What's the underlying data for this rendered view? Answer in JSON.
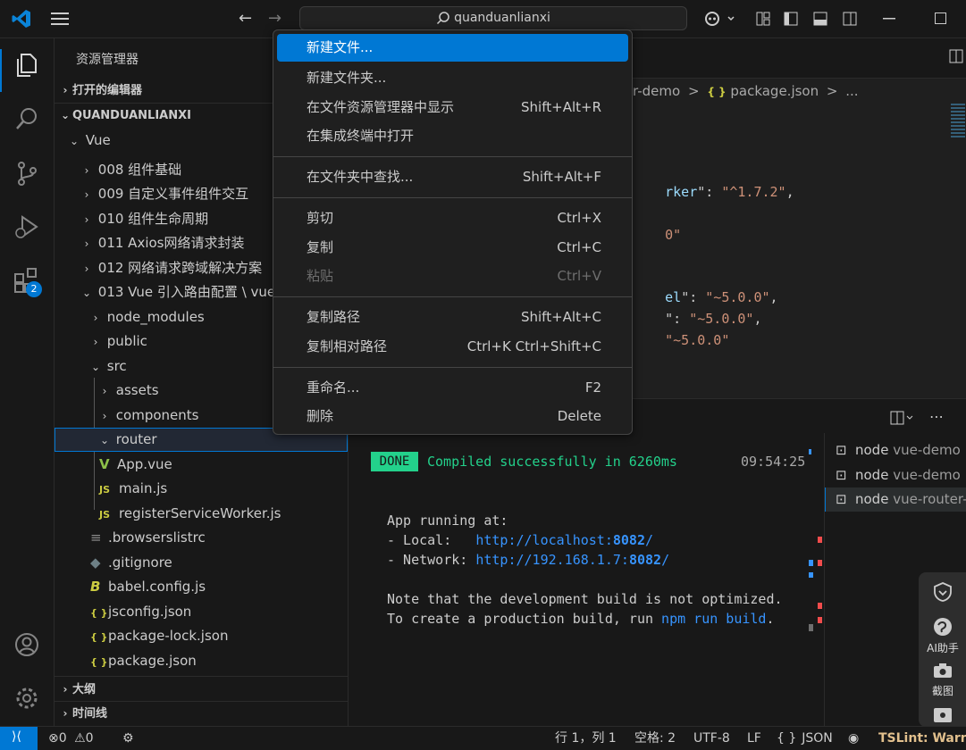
{
  "titlebar": {
    "search_text": "quanduanlianxi"
  },
  "activity": {
    "extensions_badge": "2"
  },
  "sidebar": {
    "title": "资源管理器",
    "open_editors": "打开的编辑器",
    "workspace": "QUANDUANLIANXI",
    "outline": "大纲",
    "timeline": "时间线",
    "items": [
      {
        "label": "Vue"
      },
      {
        "label": "008 组件基础"
      },
      {
        "label": "009 自定义事件组件交互"
      },
      {
        "label": "010 组件生命周期"
      },
      {
        "label": "011 Axios网络请求封装"
      },
      {
        "label": "012 网络请求跨域解决方案"
      },
      {
        "label": "013 Vue 引入路由配置 \\ vue"
      },
      {
        "label": "node_modules"
      },
      {
        "label": "public"
      },
      {
        "label": "src"
      },
      {
        "label": "assets"
      },
      {
        "label": "components"
      },
      {
        "label": "router"
      },
      {
        "label": "App.vue"
      },
      {
        "label": "main.js"
      },
      {
        "label": "registerServiceWorker.js"
      },
      {
        "label": ".browserslistrc"
      },
      {
        "label": ".gitignore"
      },
      {
        "label": "babel.config.js"
      },
      {
        "label": "jsconfig.json"
      },
      {
        "label": "package-lock.json"
      },
      {
        "label": "package.json"
      }
    ],
    "icon_js": "JS",
    "icon_json": "{ }"
  },
  "editor": {
    "breadcrumb_prev": "r-demo",
    "breadcrumb_sep": ">",
    "breadcrumb_icon": "{ }",
    "breadcrumb_file": "package.json",
    "breadcrumb_more": "...",
    "lines": [
      {
        "key": "rker",
        "rest": "\": ",
        "val": "\"^1.7.2\"",
        "end": ","
      },
      {
        "key": "",
        "rest": "",
        "val": "0\"",
        "end": ""
      },
      {
        "key": "el",
        "rest": "\": ",
        "val": "\"~5.0.0\"",
        "end": ","
      },
      {
        "key": "",
        "rest": "\": ",
        "val": "\"~5.0.0\"",
        "end": ","
      },
      {
        "key": "",
        "rest": "",
        "val": "\"~5.0.0\"",
        "end": ""
      }
    ]
  },
  "terminal": {
    "done_badge": "DONE",
    "compiled": "Compiled successfully in 6260ms",
    "time": "09:54:25",
    "app_running": "App running at:",
    "local_label": "- Local:   ",
    "local_url": "http://localhost:",
    "local_port": "8082",
    "network_label": "- Network: ",
    "network_url": "http://192.168.1.7:",
    "network_port": "8082",
    "slash": "/",
    "note1": "Note that the development build is not optimized.",
    "note2_pre": "To create a production build, run ",
    "note2_cmd": "npm run build",
    "note2_post": ".",
    "tabs": [
      {
        "name": "node",
        "desc": "vue-demo"
      },
      {
        "name": "node",
        "desc": "vue-demo"
      },
      {
        "name": "node",
        "desc": "vue-router-d"
      }
    ]
  },
  "ai_panel": {
    "ai_label": "AI助手",
    "screenshot_label": "截图"
  },
  "statusbar": {
    "errors": "0",
    "warnings": "0",
    "position": "行 1，列 1",
    "spaces": "空格: 2",
    "encoding": "UTF-8",
    "eol": "LF",
    "lang_braces": "{ }",
    "language": "JSON",
    "tslint": "TSLint: Warnin"
  },
  "context_menu": {
    "items": [
      {
        "label": "新建文件...",
        "key": ""
      },
      {
        "label": "新建文件夹...",
        "key": ""
      },
      {
        "label": "在文件资源管理器中显示",
        "key": "Shift+Alt+R"
      },
      {
        "label": "在集成终端中打开",
        "key": ""
      },
      {
        "label": "在文件夹中查找...",
        "key": "Shift+Alt+F"
      },
      {
        "label": "剪切",
        "key": "Ctrl+X"
      },
      {
        "label": "复制",
        "key": "Ctrl+C"
      },
      {
        "label": "粘贴",
        "key": "Ctrl+V"
      },
      {
        "label": "复制路径",
        "key": "Shift+Alt+C"
      },
      {
        "label": "复制相对路径",
        "key": "Ctrl+K Ctrl+Shift+C"
      },
      {
        "label": "重命名...",
        "key": "F2"
      },
      {
        "label": "删除",
        "key": "Delete"
      }
    ]
  },
  "colors": {
    "accent": "#0078d4",
    "done_bg": "#23d18b",
    "link": "#3794ff",
    "string": "#ce9178",
    "key": "#9cdcfe",
    "js": "#cbcb41",
    "vue": "#8dc149"
  }
}
